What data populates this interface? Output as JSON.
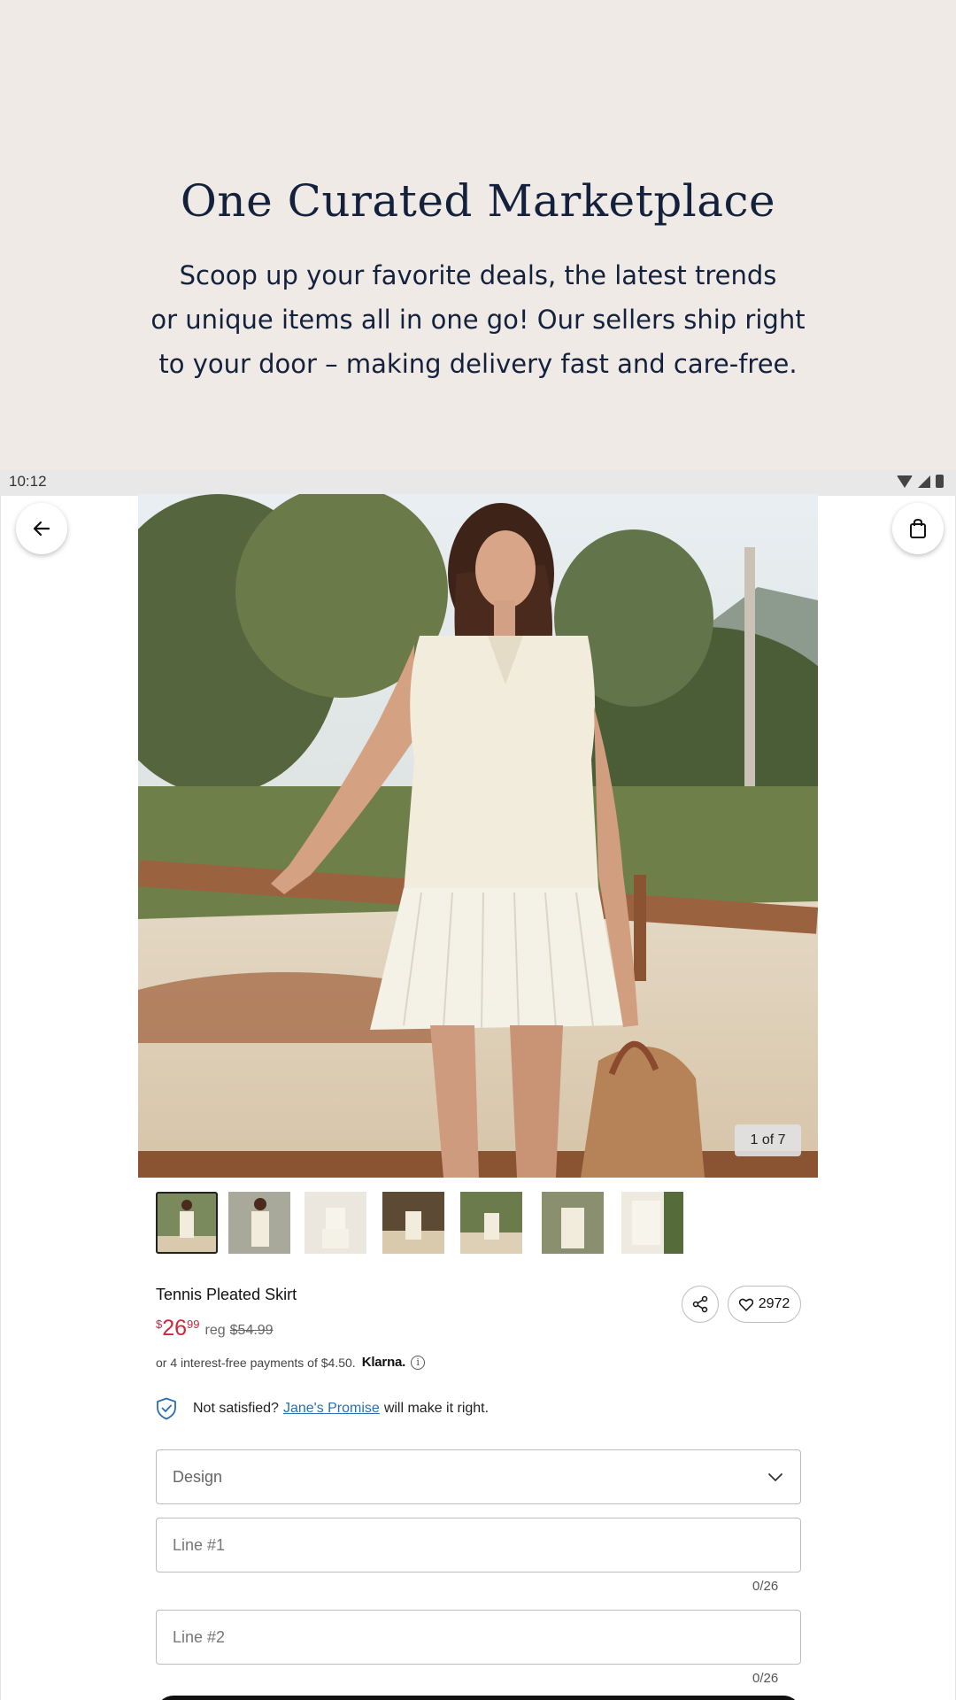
{
  "promo": {
    "title": "One Curated Marketplace",
    "line1": "Scoop up your favorite deals, the latest trends",
    "line2": "or unique items all in one go! Our sellers ship right",
    "line3": "to your door – making delivery fast and care-free."
  },
  "status_bar": {
    "time": "10:12",
    "icons": [
      "wifi-icon",
      "cell-signal-icon",
      "battery-icon"
    ]
  },
  "nav": {
    "back_icon": "arrow-left-icon",
    "cart_icon": "shopping-bag-icon"
  },
  "gallery": {
    "counter": "1 of 7",
    "thumbnail_count": 7,
    "selected_index": 0
  },
  "product": {
    "title": "Tennis Pleated Skirt",
    "price_symbol": "$",
    "price_dollars": "26",
    "price_cents": "99",
    "reg_label": "reg",
    "reg_price": "$54.99",
    "likes": "2972",
    "share_icon": "share-icon",
    "like_icon": "heart-icon"
  },
  "klarna": {
    "text": "or 4 interest-free payments of $4.50.",
    "logo": "Klarna.",
    "info_glyph": "i"
  },
  "promise": {
    "prefix": "Not satisfied?",
    "link": "Jane's Promise",
    "suffix": "will make it right."
  },
  "form": {
    "design_label": "Design",
    "line1_placeholder": "Line #1",
    "line1_count": "0/26",
    "line2_placeholder": "Line #2",
    "line2_count": "0/26"
  },
  "colors": {
    "promo_bg": "#efeae5",
    "promo_text": "#14213d",
    "price": "#d0263a",
    "link": "#2a6fb0",
    "shield": "#2a6fb0"
  }
}
